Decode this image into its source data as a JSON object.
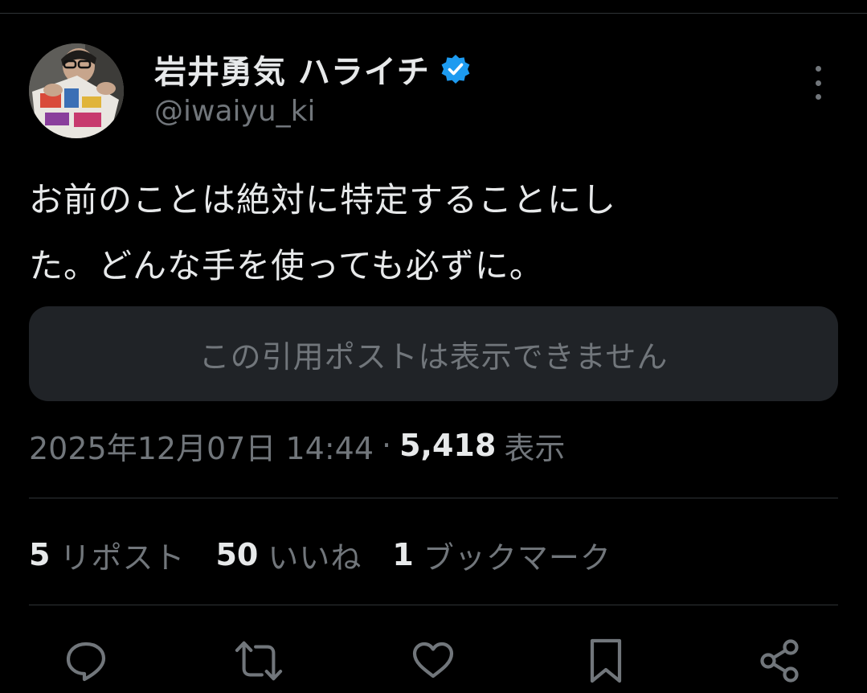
{
  "author": {
    "display_name": "岩井勇気 ハライチ",
    "handle": "@iwaiyu_ki",
    "verified": true
  },
  "tweet": {
    "lines": [
      "お前のことは絶対に特定することにし",
      "た。どんな手を使っても必ずに。"
    ]
  },
  "quote": {
    "unavailable_text": "この引用ポストは表示できません"
  },
  "meta": {
    "timestamp": "2025年12月07日 14:44",
    "separator": "·",
    "views_count": "5,418",
    "views_label": "表示"
  },
  "stats": {
    "reposts": {
      "count": "5",
      "label": "リポスト"
    },
    "likes": {
      "count": "50",
      "label": "いいね"
    },
    "bookmarks": {
      "count": "1",
      "label": "ブックマーク"
    }
  },
  "icons": {
    "more": "more-vertical-icon",
    "reply": "reply-icon",
    "repost": "repost-icon",
    "like": "heart-icon",
    "bookmark": "bookmark-icon",
    "share": "share-icon",
    "verified": "verified-badge-icon"
  },
  "colors": {
    "background": "#000000",
    "primary_text": "#e7e9ea",
    "secondary_text": "#71767b",
    "verified_blue": "#1d9bf0",
    "divider": "#2f3336",
    "quote_bg": "#202327"
  }
}
